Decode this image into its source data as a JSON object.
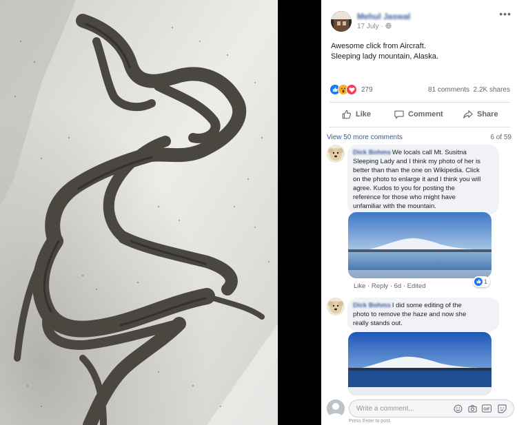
{
  "post": {
    "author_name": "Mehul Jaswal",
    "date": "17 July",
    "privacy_icon": "globe-icon",
    "more_label": "•••",
    "text_lines": [
      "Awesome click from Aircraft.",
      "Sleeping lady mountain, Alaska."
    ]
  },
  "reactions": {
    "icons": [
      "like-icon",
      "wow-icon",
      "love-icon"
    ],
    "count": "279",
    "comments": "81 comments",
    "shares": "2.2K shares",
    "colors": {
      "like": "#1877f2",
      "wow": "#f7b125",
      "love": "#f33e58"
    }
  },
  "actions": {
    "like": "Like",
    "comment": "Comment",
    "share": "Share"
  },
  "comments_section": {
    "view_more": "View 50 more comments",
    "page_count": "6 of 59"
  },
  "comments": [
    {
      "author": "Dick Bohms",
      "lines": [
        "We locals call Mt. Susitna",
        "Sleeping Lady and I think my photo of her is",
        "better than than the one on Wikipedia. Click",
        "on the photo to enlarge it and I think you will",
        "agree. Kudos to you for posting the",
        "reference for those who might have",
        "unfamiliar with the mountain."
      ],
      "like": "Like",
      "reply": "Reply",
      "age": "6d",
      "edited": "Edited",
      "reaction_count": "1"
    },
    {
      "author": "Dick Bohms",
      "lines": [
        "I did some editing of the",
        "photo to remove the haze and now she",
        "really stands out."
      ]
    }
  ],
  "composer": {
    "placeholder": "Write a comment...",
    "hint": "Press Enter to post.",
    "tools": [
      "emoji-icon",
      "camera-icon",
      "gif-icon",
      "sticker-icon"
    ],
    "gif_label": "GIF"
  }
}
